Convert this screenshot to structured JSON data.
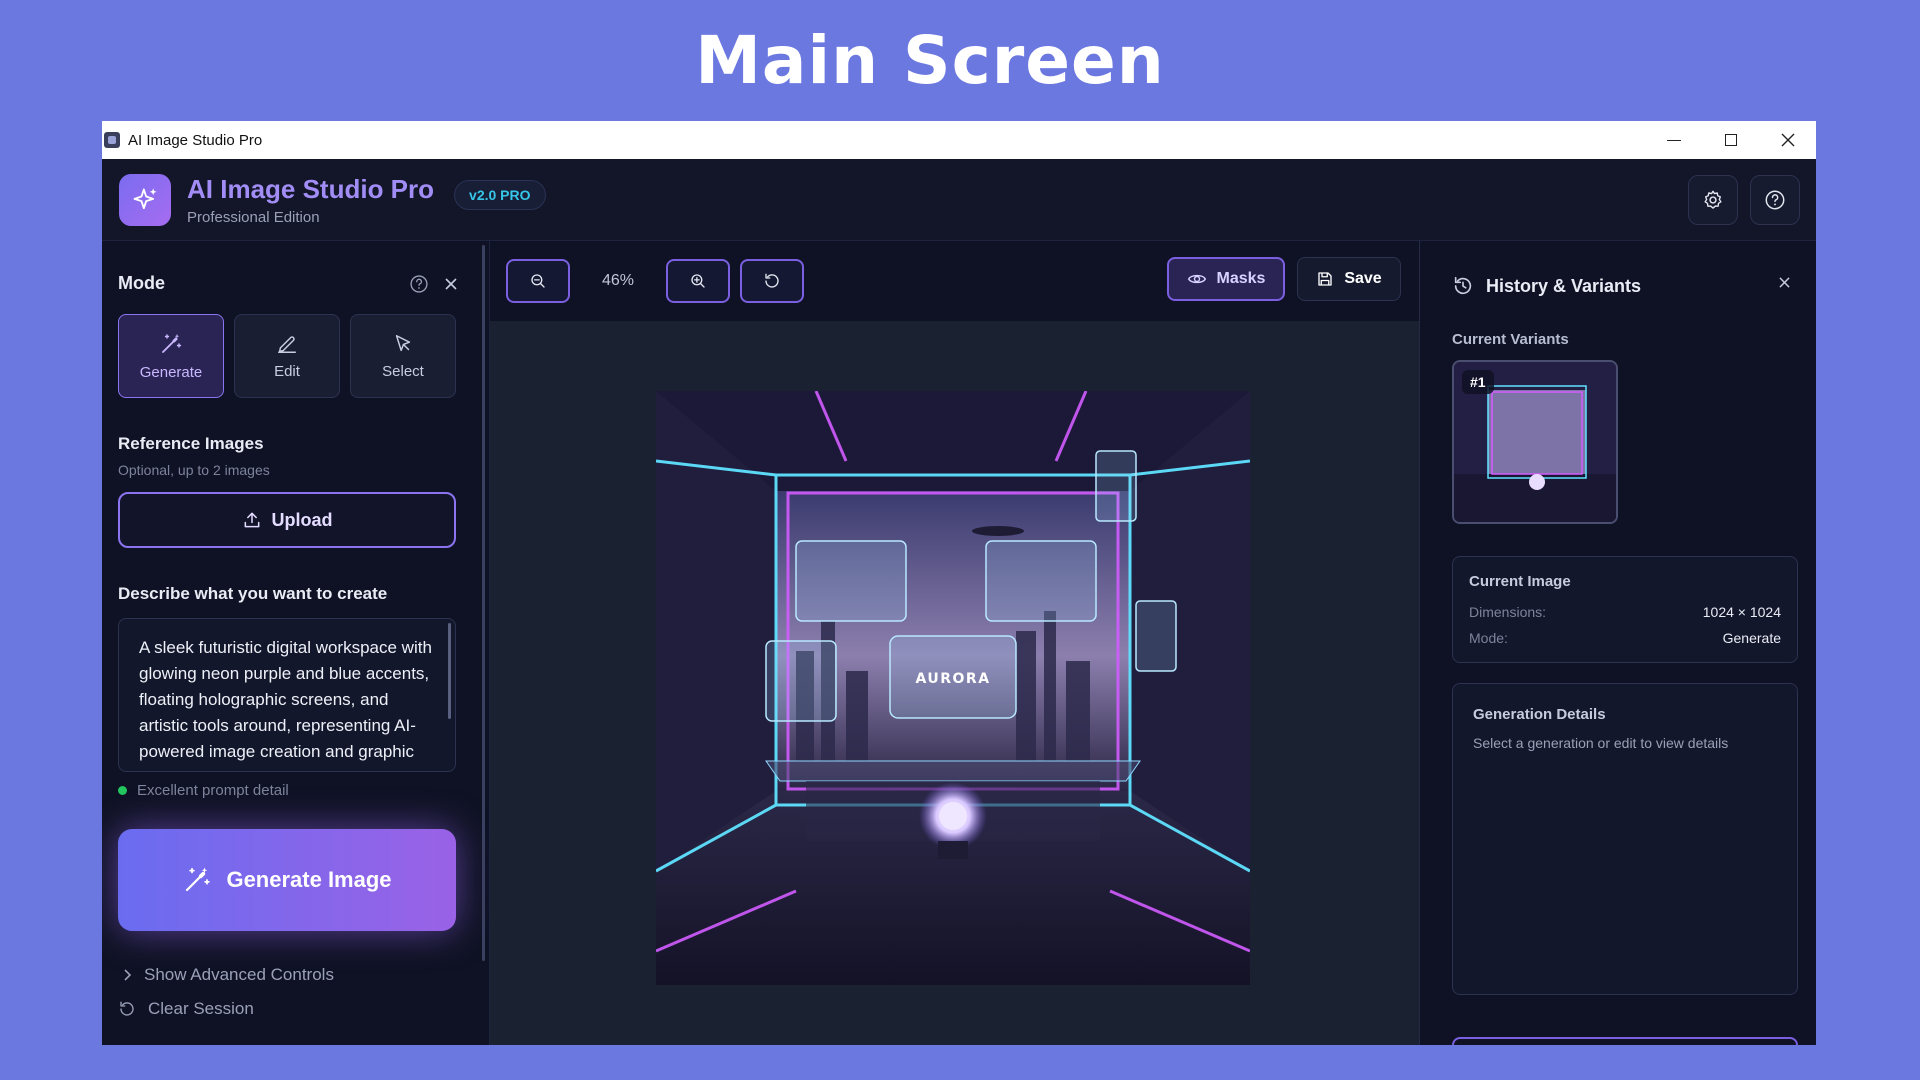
{
  "headline": "Main Screen",
  "window": {
    "title": "AI Image Studio Pro"
  },
  "header": {
    "title": "AI Image Studio Pro",
    "subtitle": "Professional Edition",
    "version": "v2.0 PRO"
  },
  "left_panel": {
    "mode_title": "Mode",
    "modes": [
      {
        "label": "Generate",
        "icon": "magic-wand-icon",
        "active": true
      },
      {
        "label": "Edit",
        "icon": "pencil-icon",
        "active": false
      },
      {
        "label": "Select",
        "icon": "cursor-icon",
        "active": false
      }
    ],
    "reference_title": "Reference Images",
    "reference_hint": "Optional, up to 2 images",
    "upload_label": "Upload",
    "prompt_title": "Describe what you want to create",
    "prompt_text": "A sleek futuristic digital workspace with glowing neon purple and blue accents, floating holographic screens, and artistic tools around, representing AI-powered image creation and graphic design",
    "prompt_quality": "Excellent prompt detail",
    "generate_label": "Generate Image",
    "advanced_label": "Show Advanced Controls",
    "clear_label": "Clear Session"
  },
  "canvas": {
    "zoom": "46%",
    "masks_label": "Masks",
    "save_label": "Save",
    "image_text": "AURORA"
  },
  "right_panel": {
    "title": "History & Variants",
    "variants_label": "Current Variants",
    "variants": [
      {
        "label": "#1"
      }
    ],
    "current_image": {
      "title": "Current Image",
      "dimensions_label": "Dimensions:",
      "dimensions_value": "1024 × 1024",
      "mode_label": "Mode:",
      "mode_value": "Generate"
    },
    "details": {
      "title": "Generation Details",
      "hint": "Select a generation or edit to view details"
    }
  },
  "colors": {
    "background": "#6b78e0",
    "app_bg": "#0d1020",
    "accent": "#8b74f0",
    "cyan": "#35c6e8",
    "success": "#22c55e"
  }
}
